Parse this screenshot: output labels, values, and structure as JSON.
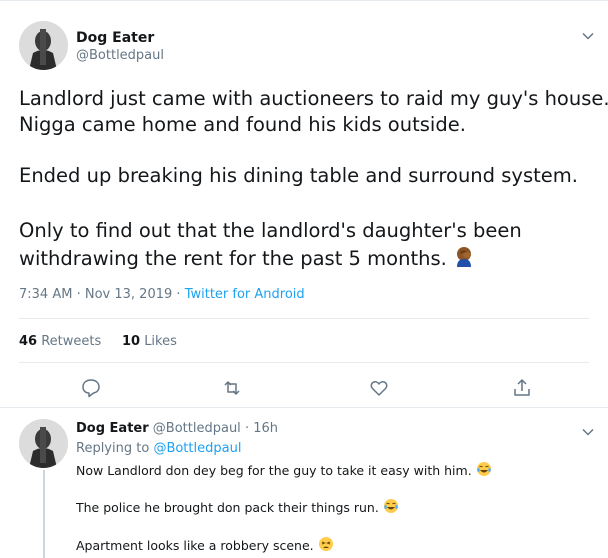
{
  "main_tweet": {
    "author_name": "Dog Eater",
    "author_handle": "@Bottledpaul",
    "lines": [
      "Landlord just came with auctioneers to raid my guy's house.",
      "Nigga came home and found his kids outside.",
      "Ended up breaking his dining table and surround system.",
      "Only to find out that the landlord's daughter's been",
      "withdrawing the rent for the past 5 months."
    ],
    "emoji": "facepalm-emoji",
    "time": "7:34 AM",
    "date": "Nov 13, 2019",
    "separator": "·",
    "source": "Twitter for Android",
    "retweets_count": "46",
    "retweets_label": "Retweets",
    "likes_count": "10",
    "likes_label": "Likes"
  },
  "reply_tweet": {
    "author_name": "Dog Eater",
    "author_handle": "@Bottledpaul",
    "separator": "·",
    "age": "16h",
    "replying_prefix": "Replying to",
    "replying_to": "@Bottledpaul",
    "lines": [
      "Now Landlord don dey beg for the guy to take it easy with him.",
      "The police he brought don pack their things run.",
      "Apartment looks like a robbery scene."
    ]
  },
  "colors": {
    "accent": "#1da1f2",
    "text": "#14171a",
    "secondary": "#657786",
    "border": "#e6ecf0"
  }
}
